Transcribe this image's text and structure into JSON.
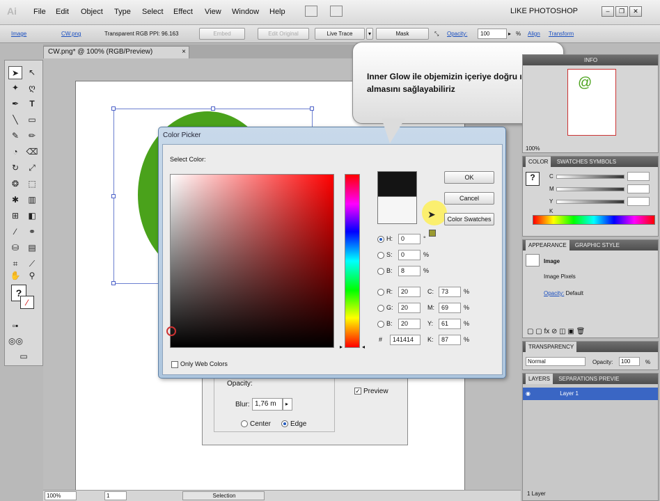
{
  "app": {
    "logo": "Ai",
    "menus": [
      "File",
      "Edit",
      "Object",
      "Type",
      "Select",
      "Effect",
      "View",
      "Window",
      "Help"
    ],
    "workspace": "LIKE PHOTOSHOP"
  },
  "control_bar": {
    "object_type": "Image",
    "file_link": "CW.png",
    "info": "Transparent RGB  PPI: 96.163",
    "embed": "Embed",
    "edit_original": "Edit Original",
    "live_trace": "Live Trace",
    "mask": "Mask",
    "opacity_label": "Opacity:",
    "opacity_value": "100",
    "opacity_unit": "%",
    "align": "Align",
    "transform": "Transform"
  },
  "document": {
    "tab_title": "CW.png* @ 100% (RGB/Preview)",
    "close": "×"
  },
  "color_picker": {
    "title": "Color Picker",
    "select_color_label": "Select Color:",
    "ok": "OK",
    "cancel": "Cancel",
    "swatches": "Color Swatches",
    "only_web_colors": "Only Web Colors",
    "hsb": [
      {
        "label": "H:",
        "value": "0",
        "unit": "°"
      },
      {
        "label": "S:",
        "value": "0",
        "unit": "%"
      },
      {
        "label": "B:",
        "value": "8",
        "unit": "%"
      }
    ],
    "rgb": [
      {
        "label": "R:",
        "value": "20"
      },
      {
        "label": "G:",
        "value": "20"
      },
      {
        "label": "B:",
        "value": "20"
      }
    ],
    "cmyk": [
      {
        "label": "C:",
        "value": "73",
        "unit": "%"
      },
      {
        "label": "M:",
        "value": "69",
        "unit": "%"
      },
      {
        "label": "Y:",
        "value": "61",
        "unit": "%"
      },
      {
        "label": "K:",
        "value": "87",
        "unit": "%"
      }
    ],
    "hex_label": "#",
    "hex_value": "141414"
  },
  "inner_glow": {
    "opacity_label": "Opacity:",
    "blur_label": "Blur:",
    "blur_value": "1,76 m",
    "center": "Center",
    "edge": "Edge",
    "preview": "Preview"
  },
  "bubble": {
    "text": "Inner Glow ile objemizin içeriye doğru ışık almasını sağlayabiliriz"
  },
  "navigator": {
    "tab": "INFO",
    "zoom": "100%"
  },
  "color_panel": {
    "tabs": [
      "COLOR",
      "SWATCHES SYMBOLS"
    ],
    "channels": [
      "C",
      "M",
      "Y",
      "K"
    ]
  },
  "appearance": {
    "tabs": [
      "APPEARANCE",
      "GRAPHIC STYLE"
    ],
    "object": "Image",
    "pixels": "Image Pixels",
    "opacity_label": "Opacity:",
    "opacity_value": "Default"
  },
  "transparency": {
    "tab": "TRANSPARENCY",
    "mode": "Normal",
    "opacity_label": "Opacity:",
    "opacity_value": "100",
    "unit": "%"
  },
  "layers": {
    "tabs": [
      "LAYERS",
      "SEPARATIONS PREVIE"
    ],
    "layer_name": "Layer 1",
    "count": "1 Layer"
  },
  "status": {
    "zoom": "100%",
    "page": "1",
    "tool": "Selection"
  }
}
